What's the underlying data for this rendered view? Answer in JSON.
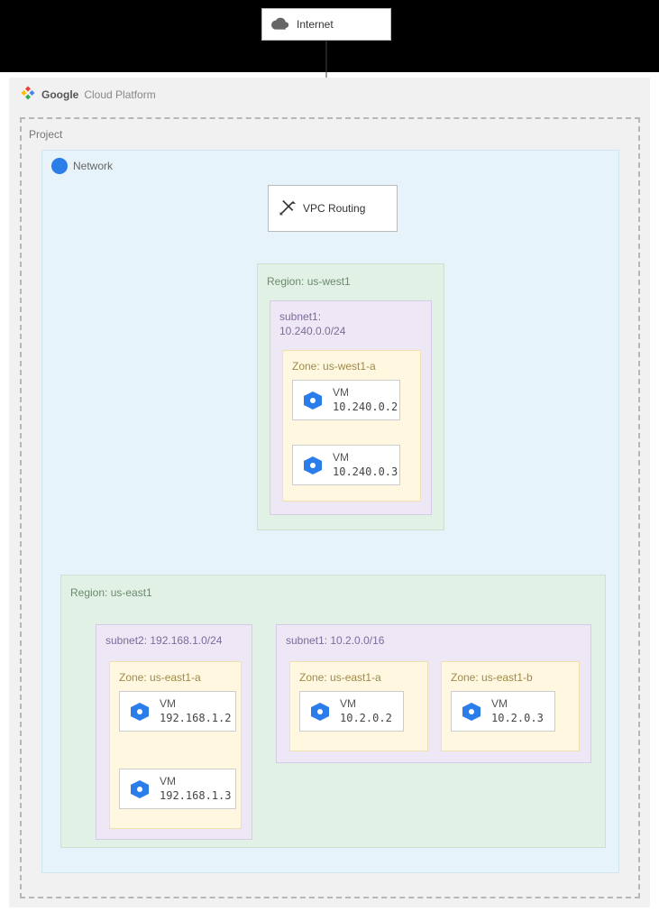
{
  "internet_label": "Internet",
  "gcp_brand1": "Google",
  "gcp_brand2": "Cloud Platform",
  "project_label": "Project",
  "network_label": "Network",
  "vpc_routing_label": "VPC Routing",
  "region1_label": "Region: us-west1",
  "region2_label": "Region: us-east1",
  "subnet1a_line1": "subnet1:",
  "subnet1a_line2": "10.240.0.0/24",
  "subnet2_label": "subnet2: 192.168.1.0/24",
  "subnet1b_label": "subnet1: 10.2.0.0/16",
  "zone1a_label": "Zone: us-west1-a",
  "zone2a_label": "Zone: us-east1-a",
  "zone1ba_label": "Zone: us-east1-a",
  "zone1bb_label": "Zone: us-east1-b",
  "vm_title": "VM",
  "vm1_ip": "10.240.0.2",
  "vm2_ip": "10.240.0.3",
  "vm3_ip": "192.168.1.2",
  "vm4_ip": "192.168.1.3",
  "vm5_ip": "10.2.0.2",
  "vm6_ip": "10.2.0.3",
  "icons": {
    "cloud": "cloud-icon",
    "gcp_logo": "gcp-logo-icon",
    "network": "network-icon",
    "routing": "routing-icon",
    "compute": "compute-engine-icon"
  },
  "colors": {
    "gcp_bg": "#f1f1f1",
    "network_bg": "#e6f3fb",
    "region_bg": "#e2f1e5",
    "subnet_bg": "#ede7f6",
    "zone_bg": "#fff7e0",
    "icon_blue": "#2b7de9"
  }
}
